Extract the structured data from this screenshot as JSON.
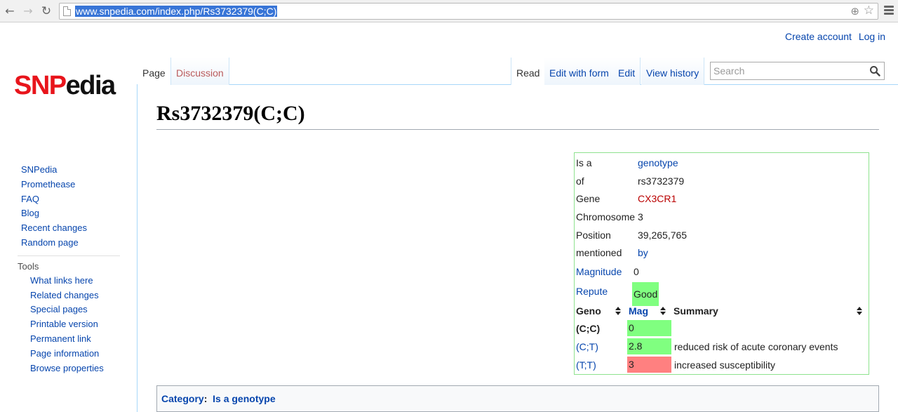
{
  "browser": {
    "url": "www.snpedia.com/index.php/Rs3732379(C;C)"
  },
  "personal": {
    "create_account": "Create account",
    "log_in": "Log in"
  },
  "logo": {
    "part1": "SNP",
    "part2": "edia"
  },
  "tabs": {
    "page": "Page",
    "discussion": "Discussion",
    "read": "Read",
    "edit_with_form": "Edit with form",
    "edit": "Edit",
    "view_history": "View history"
  },
  "search": {
    "placeholder": "Search"
  },
  "sidebar": {
    "main": [
      "SNPedia",
      "Promethease",
      "FAQ",
      "Blog",
      "Recent changes",
      "Random page"
    ],
    "tools_heading": "Tools",
    "tools": [
      "What links here",
      "Related changes",
      "Special pages",
      "Printable version",
      "Permanent link",
      "Page information",
      "Browse properties"
    ]
  },
  "page": {
    "title": "Rs3732379(C;C)"
  },
  "infobox": {
    "is_a_label": "Is a",
    "is_a_value": "genotype",
    "of_label": "of",
    "of_value": "rs3732379",
    "gene_label": "Gene",
    "gene_value": "CX3CR1",
    "chromosome_label": "Chromosome",
    "chromosome_value": "3",
    "position_label": "Position",
    "position_value": "39,265,765",
    "mentioned_label": "mentioned",
    "mentioned_value": "by",
    "magnitude_label": "Magnitude",
    "magnitude_value": "0",
    "repute_label": "Repute",
    "repute_value": "Good",
    "table_headers": {
      "geno": "Geno",
      "mag": "Mag",
      "summary": "Summary"
    },
    "rows": [
      {
        "geno": "(C;C)",
        "mag": "0",
        "summary": ""
      },
      {
        "geno": "(C;T)",
        "mag": "2.8",
        "summary": "reduced risk of acute coronary events"
      },
      {
        "geno": "(T;T)",
        "mag": "3",
        "summary": "increased susceptibility"
      }
    ]
  },
  "category": {
    "label": "Category",
    "colon": ":",
    "value": "Is a genotype"
  },
  "colors": {
    "link": "#0645ad",
    "new_link": "#ba0000",
    "good": "#80ff80",
    "bad": "#ff8080",
    "logo_red": "#e8141b"
  }
}
